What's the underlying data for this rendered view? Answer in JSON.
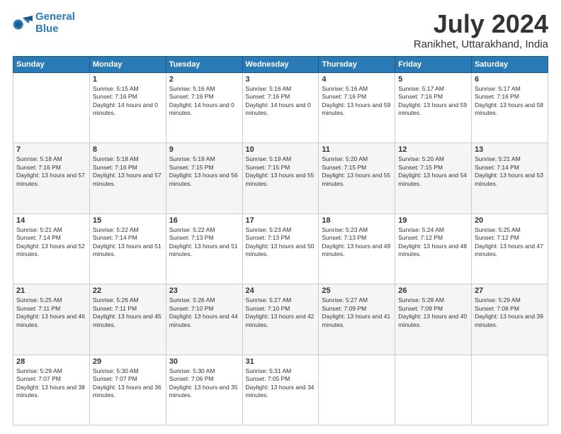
{
  "logo": {
    "line1": "General",
    "line2": "Blue"
  },
  "title": {
    "month": "July 2024",
    "location": "Ranikhet, Uttarakhand, India"
  },
  "weekdays": [
    "Sunday",
    "Monday",
    "Tuesday",
    "Wednesday",
    "Thursday",
    "Friday",
    "Saturday"
  ],
  "weeks": [
    [
      {
        "day": "",
        "sunrise": "",
        "sunset": "",
        "daylight": ""
      },
      {
        "day": "1",
        "sunrise": "Sunrise: 5:15 AM",
        "sunset": "Sunset: 7:16 PM",
        "daylight": "Daylight: 14 hours and 0 minutes."
      },
      {
        "day": "2",
        "sunrise": "Sunrise: 5:16 AM",
        "sunset": "Sunset: 7:16 PM",
        "daylight": "Daylight: 14 hours and 0 minutes."
      },
      {
        "day": "3",
        "sunrise": "Sunrise: 5:16 AM",
        "sunset": "Sunset: 7:16 PM",
        "daylight": "Daylight: 14 hours and 0 minutes."
      },
      {
        "day": "4",
        "sunrise": "Sunrise: 5:16 AM",
        "sunset": "Sunset: 7:16 PM",
        "daylight": "Daylight: 13 hours and 59 minutes."
      },
      {
        "day": "5",
        "sunrise": "Sunrise: 5:17 AM",
        "sunset": "Sunset: 7:16 PM",
        "daylight": "Daylight: 13 hours and 59 minutes."
      },
      {
        "day": "6",
        "sunrise": "Sunrise: 5:17 AM",
        "sunset": "Sunset: 7:16 PM",
        "daylight": "Daylight: 13 hours and 58 minutes."
      }
    ],
    [
      {
        "day": "7",
        "sunrise": "Sunrise: 5:18 AM",
        "sunset": "Sunset: 7:16 PM",
        "daylight": "Daylight: 13 hours and 57 minutes."
      },
      {
        "day": "8",
        "sunrise": "Sunrise: 5:18 AM",
        "sunset": "Sunset: 7:16 PM",
        "daylight": "Daylight: 13 hours and 57 minutes."
      },
      {
        "day": "9",
        "sunrise": "Sunrise: 5:19 AM",
        "sunset": "Sunset: 7:15 PM",
        "daylight": "Daylight: 13 hours and 56 minutes."
      },
      {
        "day": "10",
        "sunrise": "Sunrise: 5:19 AM",
        "sunset": "Sunset: 7:15 PM",
        "daylight": "Daylight: 13 hours and 55 minutes."
      },
      {
        "day": "11",
        "sunrise": "Sunrise: 5:20 AM",
        "sunset": "Sunset: 7:15 PM",
        "daylight": "Daylight: 13 hours and 55 minutes."
      },
      {
        "day": "12",
        "sunrise": "Sunrise: 5:20 AM",
        "sunset": "Sunset: 7:15 PM",
        "daylight": "Daylight: 13 hours and 54 minutes."
      },
      {
        "day": "13",
        "sunrise": "Sunrise: 5:21 AM",
        "sunset": "Sunset: 7:14 PM",
        "daylight": "Daylight: 13 hours and 53 minutes."
      }
    ],
    [
      {
        "day": "14",
        "sunrise": "Sunrise: 5:21 AM",
        "sunset": "Sunset: 7:14 PM",
        "daylight": "Daylight: 13 hours and 52 minutes."
      },
      {
        "day": "15",
        "sunrise": "Sunrise: 5:22 AM",
        "sunset": "Sunset: 7:14 PM",
        "daylight": "Daylight: 13 hours and 51 minutes."
      },
      {
        "day": "16",
        "sunrise": "Sunrise: 5:22 AM",
        "sunset": "Sunset: 7:13 PM",
        "daylight": "Daylight: 13 hours and 51 minutes."
      },
      {
        "day": "17",
        "sunrise": "Sunrise: 5:23 AM",
        "sunset": "Sunset: 7:13 PM",
        "daylight": "Daylight: 13 hours and 50 minutes."
      },
      {
        "day": "18",
        "sunrise": "Sunrise: 5:23 AM",
        "sunset": "Sunset: 7:13 PM",
        "daylight": "Daylight: 13 hours and 49 minutes."
      },
      {
        "day": "19",
        "sunrise": "Sunrise: 5:24 AM",
        "sunset": "Sunset: 7:12 PM",
        "daylight": "Daylight: 13 hours and 48 minutes."
      },
      {
        "day": "20",
        "sunrise": "Sunrise: 5:25 AM",
        "sunset": "Sunset: 7:12 PM",
        "daylight": "Daylight: 13 hours and 47 minutes."
      }
    ],
    [
      {
        "day": "21",
        "sunrise": "Sunrise: 5:25 AM",
        "sunset": "Sunset: 7:11 PM",
        "daylight": "Daylight: 13 hours and 46 minutes."
      },
      {
        "day": "22",
        "sunrise": "Sunrise: 5:26 AM",
        "sunset": "Sunset: 7:11 PM",
        "daylight": "Daylight: 13 hours and 45 minutes."
      },
      {
        "day": "23",
        "sunrise": "Sunrise: 5:26 AM",
        "sunset": "Sunset: 7:10 PM",
        "daylight": "Daylight: 13 hours and 44 minutes."
      },
      {
        "day": "24",
        "sunrise": "Sunrise: 5:27 AM",
        "sunset": "Sunset: 7:10 PM",
        "daylight": "Daylight: 13 hours and 42 minutes."
      },
      {
        "day": "25",
        "sunrise": "Sunrise: 5:27 AM",
        "sunset": "Sunset: 7:09 PM",
        "daylight": "Daylight: 13 hours and 41 minutes."
      },
      {
        "day": "26",
        "sunrise": "Sunrise: 5:28 AM",
        "sunset": "Sunset: 7:09 PM",
        "daylight": "Daylight: 13 hours and 40 minutes."
      },
      {
        "day": "27",
        "sunrise": "Sunrise: 5:29 AM",
        "sunset": "Sunset: 7:08 PM",
        "daylight": "Daylight: 13 hours and 39 minutes."
      }
    ],
    [
      {
        "day": "28",
        "sunrise": "Sunrise: 5:29 AM",
        "sunset": "Sunset: 7:07 PM",
        "daylight": "Daylight: 13 hours and 38 minutes."
      },
      {
        "day": "29",
        "sunrise": "Sunrise: 5:30 AM",
        "sunset": "Sunset: 7:07 PM",
        "daylight": "Daylight: 13 hours and 36 minutes."
      },
      {
        "day": "30",
        "sunrise": "Sunrise: 5:30 AM",
        "sunset": "Sunset: 7:06 PM",
        "daylight": "Daylight: 13 hours and 35 minutes."
      },
      {
        "day": "31",
        "sunrise": "Sunrise: 5:31 AM",
        "sunset": "Sunset: 7:05 PM",
        "daylight": "Daylight: 13 hours and 34 minutes."
      },
      {
        "day": "",
        "sunrise": "",
        "sunset": "",
        "daylight": ""
      },
      {
        "day": "",
        "sunrise": "",
        "sunset": "",
        "daylight": ""
      },
      {
        "day": "",
        "sunrise": "",
        "sunset": "",
        "daylight": ""
      }
    ]
  ]
}
